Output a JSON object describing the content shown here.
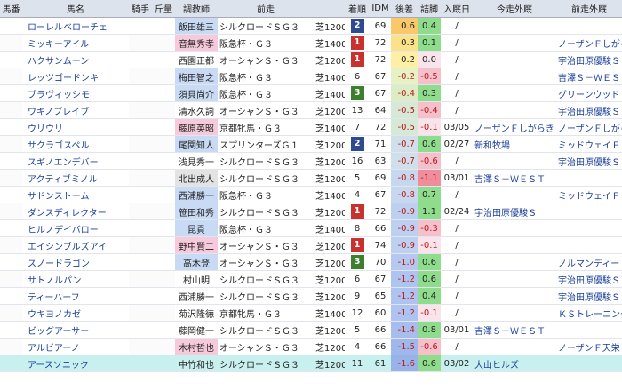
{
  "headers": {
    "uma": "馬番",
    "name": "馬名",
    "jockey": "騎手",
    "weight": "斤量",
    "trainer": "調教師",
    "prev": "前走",
    "rank": "着順",
    "idm": "IDM",
    "diff": "後差",
    "agari": "詰脚",
    "date": "入厩日",
    "next": "今走外厩",
    "prevout": "前走外厩"
  },
  "rows": [
    {
      "name": "ローレルベローチェ",
      "trainer": "飯田雄三",
      "tr_color": "blue",
      "race": "シルクロードＳＧ３",
      "dist": "芝1200",
      "rank": "2",
      "idm": "69",
      "diff": "0.6",
      "agari": "0.4",
      "diff_c": "#f8c86a",
      "agari_c": "#8fdc8c",
      "date": "/",
      "next": "",
      "prevout": ""
    },
    {
      "name": "ミッキーアイル",
      "trainer": "音無秀孝",
      "tr_color": "pink",
      "race": "阪急杯・Ｇ３",
      "dist": "芝1400",
      "rank": "1",
      "idm": "72",
      "diff": "0.3",
      "agari": "0.1",
      "diff_c": "#fbe18a",
      "agari_c": "#8fdc8c",
      "date": "/",
      "next": "",
      "prevout": "ノーザンＦしがらき"
    },
    {
      "name": "ハクサンムーン",
      "trainer": "西園正都",
      "tr_color": "",
      "race": "オーシャンＳ・Ｇ３",
      "dist": "芝1200",
      "rank": "1",
      "idm": "72",
      "diff": "0.2",
      "agari": "0.0",
      "diff_c": "#fdf0a6",
      "agari_c": "#f9e4ec",
      "date": "/",
      "next": "",
      "prevout": "宇治田原優駿Ｓ"
    },
    {
      "name": "レッツゴードンキ",
      "trainer": "梅田智之",
      "tr_color": "blue",
      "race": "阪急杯・Ｇ３",
      "dist": "芝1400",
      "rank": "6",
      "idm": "67",
      "diff": "-0.2",
      "agari": "-0.5",
      "diff_c": "#e6f2c4",
      "agari_c": "#f4c0cc",
      "date": "/",
      "next": "",
      "prevout": "吉澤Ｓ－ＷＥＳＴ"
    },
    {
      "name": "ブラヴィッシモ",
      "trainer": "須貝尚介",
      "tr_color": "blue",
      "race": "阪急杯・Ｇ３",
      "dist": "芝1400",
      "rank": "3",
      "idm": "67",
      "diff": "-0.4",
      "agari": "0.3",
      "diff_c": "#dcedc6",
      "agari_c": "#8fdc8c",
      "date": "/",
      "next": "",
      "prevout": "グリーンウッド"
    },
    {
      "name": "ワキノブレイブ",
      "trainer": "清水久詞",
      "tr_color": "",
      "race": "オーシャンＳ・Ｇ３",
      "dist": "芝1200",
      "rank": "13",
      "idm": "64",
      "diff": "-0.5",
      "agari": "-0.4",
      "diff_c": "#d6e8d6",
      "agari_c": "#f4c0cc",
      "date": "/",
      "next": "",
      "prevout": "宇治田原優駿Ｓ"
    },
    {
      "name": "ウリウリ",
      "trainer": "藤原英昭",
      "tr_color": "pink",
      "race": "京都牝馬・Ｇ３",
      "dist": "芝1400",
      "rank": "7",
      "idm": "72",
      "diff": "-0.5",
      "agari": "-0.1",
      "diff_c": "#d6e8d6",
      "agari_c": "#f9e4ec",
      "date": "03/05",
      "next": "ノーザンＦしがらき",
      "prevout": "ノーザンＦしがらき"
    },
    {
      "name": "サクラゴスペル",
      "trainer": "尾関知人",
      "tr_color": "blue",
      "race": "スプリンターズＧ１",
      "dist": "芝1200",
      "rank": "2",
      "idm": "71",
      "diff": "-0.7",
      "agari": "0.6",
      "diff_c": "#cfe0ea",
      "agari_c": "#8fdc8c",
      "date": "02/27",
      "next": "新和牧場",
      "prevout": "ミッドウェイＦ"
    },
    {
      "name": "スギノエンデバー",
      "trainer": "浅見秀一",
      "tr_color": "",
      "race": "シルクロードＳＧ３",
      "dist": "芝1200",
      "rank": "16",
      "idm": "63",
      "diff": "-0.7",
      "agari": "-0.6",
      "diff_c": "#cfe0ea",
      "agari_c": "#f4c0cc",
      "date": "/",
      "next": "",
      "prevout": "宇治田原優駿Ｓ"
    },
    {
      "name": "アクティブミノル",
      "trainer": "北出成人",
      "tr_color": "gray",
      "race": "シルクロードＳＧ３",
      "dist": "芝1200",
      "rank": "5",
      "idm": "69",
      "diff": "-0.8",
      "agari": "-1.1",
      "diff_c": "#c6d7ee",
      "agari_c": "#f08d9c",
      "date": "03/01",
      "next": "吉澤Ｓ－ＷＥＳＴ",
      "prevout": ""
    },
    {
      "name": "サドンストーム",
      "trainer": "西浦勝一",
      "tr_color": "blue",
      "race": "阪急杯・Ｇ３",
      "dist": "芝1400",
      "rank": "4",
      "idm": "67",
      "diff": "-0.8",
      "agari": "0.7",
      "diff_c": "#c6d7ee",
      "agari_c": "#8fdc8c",
      "date": "/",
      "next": "",
      "prevout": "ミッドウェイＦ"
    },
    {
      "name": "ダンスディレクター",
      "trainer": "笹田和秀",
      "tr_color": "blue",
      "race": "シルクロードＳＧ３",
      "dist": "芝1200",
      "rank": "1",
      "idm": "72",
      "diff": "-0.9",
      "agari": "1.1",
      "diff_c": "#bcd0f0",
      "agari_c": "#8fdc8c",
      "date": "02/24",
      "next": "宇治田原優駿Ｓ",
      "prevout": ""
    },
    {
      "name": "ヒルノデイバロー",
      "trainer": "昆貢",
      "tr_color": "blue",
      "race": "阪急杯・Ｇ３",
      "dist": "芝1400",
      "rank": "8",
      "idm": "66",
      "diff": "-0.9",
      "agari": "-0.3",
      "diff_c": "#bcd0f0",
      "agari_c": "#f4c0cc",
      "date": "/",
      "next": "",
      "prevout": ""
    },
    {
      "name": "エイシンブルズアイ",
      "trainer": "野中賢二",
      "tr_color": "pink",
      "race": "オーシャンＳ・Ｇ３",
      "dist": "芝1200",
      "rank": "1",
      "idm": "74",
      "diff": "-0.9",
      "agari": "-0.1",
      "diff_c": "#bcd0f0",
      "agari_c": "#f9e4ec",
      "date": "/",
      "next": "",
      "prevout": ""
    },
    {
      "name": "スノードラゴン",
      "trainer": "高木登",
      "tr_color": "blue",
      "race": "オーシャンＳ・Ｇ３",
      "dist": "芝1200",
      "rank": "3",
      "idm": "70",
      "diff": "-1.0",
      "agari": "0.6",
      "diff_c": "#b4c8f0",
      "agari_c": "#8fdc8c",
      "date": "/",
      "next": "",
      "prevout": "ノルマンディーＦ"
    },
    {
      "name": "サトノルパン",
      "trainer": "村山明",
      "tr_color": "",
      "race": "シルクロードＳＧ３",
      "dist": "芝1200",
      "rank": "6",
      "idm": "67",
      "diff": "-1.2",
      "agari": "0.6",
      "diff_c": "#adc3f0",
      "agari_c": "#8fdc8c",
      "date": "/",
      "next": "",
      "prevout": "宇治田原優駿Ｓ"
    },
    {
      "name": "ティーハーフ",
      "trainer": "西浦勝一",
      "tr_color": "",
      "race": "シルクロードＳＧ３",
      "dist": "芝1200",
      "rank": "9",
      "idm": "65",
      "diff": "-1.2",
      "agari": "0.4",
      "diff_c": "#adc3f0",
      "agari_c": "#8fdc8c",
      "date": "/",
      "next": "",
      "prevout": "宇治田原優駿Ｓ"
    },
    {
      "name": "ウキヨノカゼ",
      "trainer": "菊沢隆徳",
      "tr_color": "",
      "race": "京都牝馬・Ｇ３",
      "dist": "芝1400",
      "rank": "12",
      "idm": "60",
      "diff": "-1.2",
      "agari": "-0.1",
      "diff_c": "#adc3f0",
      "agari_c": "#f9e4ec",
      "date": "/",
      "next": "",
      "prevout": "ＫＳトレーニングＣ"
    },
    {
      "name": "ビッグアーサー",
      "trainer": "藤岡健一",
      "tr_color": "",
      "race": "シルクロードＳＧ３",
      "dist": "芝1200",
      "rank": "5",
      "idm": "66",
      "diff": "-1.4",
      "agari": "0.8",
      "diff_c": "#a6bdee",
      "agari_c": "#8fdc8c",
      "date": "03/01",
      "next": "吉澤Ｓ－ＷＥＳＴ",
      "prevout": ""
    },
    {
      "name": "アルビアーノ",
      "trainer": "木村哲也",
      "tr_color": "pink",
      "race": "オーシャンＳ・Ｇ３",
      "dist": "芝1200",
      "rank": "4",
      "idm": "66",
      "diff": "-1.5",
      "agari": "-0.6",
      "diff_c": "#9fb8ec",
      "agari_c": "#f4c0cc",
      "date": "/",
      "next": "",
      "prevout": "ノーザンＦ天栄"
    },
    {
      "name": "アースソニック",
      "trainer": "中竹和也",
      "tr_color": "blue",
      "race": "シルクロードＳＧ３",
      "dist": "芝1200",
      "rank": "11",
      "idm": "61",
      "diff": "-1.6",
      "agari": "0.6",
      "diff_c": "#98b2ea",
      "agari_c": "#8fdc8c",
      "date": "03/02",
      "next": "大山ヒルズ",
      "prevout": ""
    }
  ],
  "colors": {
    "header_bg": "#dde3ec",
    "badge1": "#c8322e",
    "badge2": "#2f4a8f",
    "badge3": "#3e7f2e",
    "last_row": "#c7f0ee"
  }
}
